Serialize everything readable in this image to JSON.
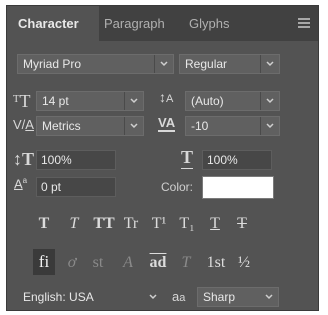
{
  "tabs": [
    {
      "label": "Character"
    },
    {
      "label": "Paragraph"
    },
    {
      "label": "Glyphs"
    }
  ],
  "font": {
    "family": "Myriad Pro",
    "style": "Regular"
  },
  "size": {
    "value": "14 pt"
  },
  "leading": {
    "value": "(Auto)"
  },
  "kerning": {
    "value": "Metrics"
  },
  "tracking": {
    "value": "-10"
  },
  "vertical_scale": {
    "value": "100%"
  },
  "horizontal_scale": {
    "value": "100%"
  },
  "baseline_shift": {
    "value": "0 pt"
  },
  "color": {
    "label": "Color:",
    "swatch": "#ffffff"
  },
  "type_style_glyphs": [
    "T",
    "T",
    "TT",
    "Tr",
    "T¹",
    "T₁",
    "T",
    "T"
  ],
  "opentype_glyphs": [
    "fi",
    "ơ",
    "st",
    "A",
    "ad",
    "T",
    "1st",
    "½"
  ],
  "language": {
    "value": "English: USA"
  },
  "antialias": {
    "value": "Sharp"
  },
  "colors": {
    "panel": "#535353",
    "tabbar": "#414141",
    "text": "#e8e8e8"
  }
}
